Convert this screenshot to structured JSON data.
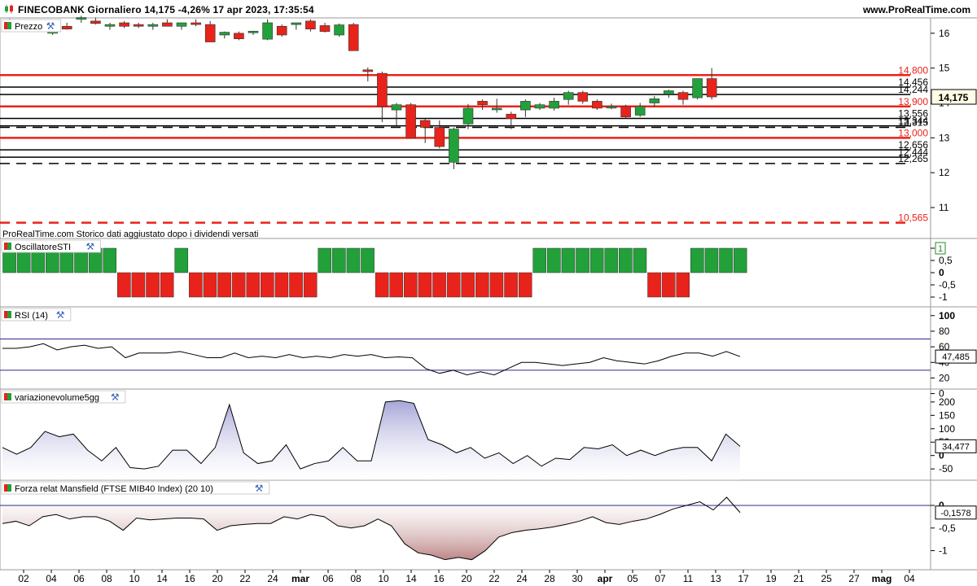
{
  "header": {
    "title": "FINECOBANK Giornaliero 14,175 -4,26% 17 apr 2023, 17:35:54",
    "brand": "www.ProRealTime.com"
  },
  "colors": {
    "bull": "#22a03a",
    "bear": "#e8231b",
    "level_red": "#e8231b",
    "level_black": "#000000",
    "rsi_band": "#2b2b8a",
    "volume_fill": "#b8b8dc",
    "mansfield_fill_neg": "#cfa0a0",
    "mansfield_fill_pos": "#c0dcc0"
  },
  "xaxis": {
    "labels": [
      "02",
      "04",
      "06",
      "08",
      "10",
      "14",
      "16",
      "20",
      "22",
      "24",
      "mar",
      "06",
      "08",
      "10",
      "14",
      "16",
      "20",
      "22",
      "24",
      "28",
      "30",
      "apr",
      "05",
      "07",
      "11",
      "13",
      "17",
      "19",
      "21",
      "25",
      "27",
      "mag",
      "04"
    ],
    "bold": [
      "mar",
      "apr",
      "mag"
    ]
  },
  "chart_data": [
    {
      "type": "candlestick",
      "panel_label": "Prezzo",
      "price_axis": {
        "range": [
          10.3,
          16.3
        ],
        "ticks": [
          "16",
          "15",
          "14",
          "13",
          "12",
          "11"
        ]
      },
      "candles": [
        {
          "i": 0,
          "o": 16.3,
          "h": 16.42,
          "l": 16.22,
          "c": 16.38
        },
        {
          "i": 1,
          "o": 16.25,
          "h": 16.3,
          "l": 16.15,
          "c": 16.17
        },
        {
          "i": 2,
          "o": 16.28,
          "h": 16.35,
          "l": 16.2,
          "c": 16.32
        },
        {
          "i": 3,
          "o": 16.0,
          "h": 16.1,
          "l": 15.95,
          "c": 16.05
        },
        {
          "i": 4,
          "o": 16.2,
          "h": 16.3,
          "l": 16.1,
          "c": 16.12
        },
        {
          "i": 5,
          "o": 16.4,
          "h": 16.5,
          "l": 16.3,
          "c": 16.45
        },
        {
          "i": 6,
          "o": 16.35,
          "h": 16.45,
          "l": 16.25,
          "c": 16.28
        },
        {
          "i": 7,
          "o": 16.2,
          "h": 16.3,
          "l": 16.1,
          "c": 16.25
        },
        {
          "i": 8,
          "o": 16.3,
          "h": 16.35,
          "l": 16.15,
          "c": 16.2
        },
        {
          "i": 9,
          "o": 16.25,
          "h": 16.3,
          "l": 16.15,
          "c": 16.2
        },
        {
          "i": 10,
          "o": 16.2,
          "h": 16.3,
          "l": 16.1,
          "c": 16.25
        },
        {
          "i": 11,
          "o": 16.3,
          "h": 16.4,
          "l": 16.2,
          "c": 16.2
        },
        {
          "i": 12,
          "o": 16.2,
          "h": 16.3,
          "l": 16.1,
          "c": 16.3
        },
        {
          "i": 13,
          "o": 16.3,
          "h": 16.4,
          "l": 16.2,
          "c": 16.25
        },
        {
          "i": 14,
          "o": 16.25,
          "h": 16.35,
          "l": 15.8,
          "c": 15.75
        },
        {
          "i": 15,
          "o": 15.95,
          "h": 16.05,
          "l": 15.85,
          "c": 16.03
        },
        {
          "i": 16,
          "o": 16.0,
          "h": 16.05,
          "l": 15.8,
          "c": 15.84
        },
        {
          "i": 17,
          "o": 16.02,
          "h": 16.07,
          "l": 15.95,
          "c": 16.06
        },
        {
          "i": 18,
          "o": 15.83,
          "h": 16.4,
          "l": 15.8,
          "c": 16.3
        },
        {
          "i": 19,
          "o": 16.2,
          "h": 16.25,
          "l": 15.9,
          "c": 15.95
        },
        {
          "i": 20,
          "o": 16.25,
          "h": 16.3,
          "l": 16.1,
          "c": 16.3
        },
        {
          "i": 21,
          "o": 16.35,
          "h": 16.4,
          "l": 16.05,
          "c": 16.12
        },
        {
          "i": 22,
          "o": 16.22,
          "h": 16.3,
          "l": 16.02,
          "c": 16.05
        },
        {
          "i": 23,
          "o": 15.95,
          "h": 16.28,
          "l": 15.9,
          "c": 16.24
        },
        {
          "i": 24,
          "o": 16.25,
          "h": 16.3,
          "l": 15.5,
          "c": 15.5
        },
        {
          "i": 25,
          "o": 14.95,
          "h": 15.02,
          "l": 14.62,
          "c": 14.9
        },
        {
          "i": 26,
          "o": 14.85,
          "h": 14.9,
          "l": 13.45,
          "c": 13.9
        },
        {
          "i": 27,
          "o": 13.8,
          "h": 14.0,
          "l": 13.35,
          "c": 13.95
        },
        {
          "i": 28,
          "o": 13.95,
          "h": 14.0,
          "l": 13.0,
          "c": 13.0
        },
        {
          "i": 29,
          "o": 13.5,
          "h": 13.55,
          "l": 12.85,
          "c": 13.3
        },
        {
          "i": 30,
          "o": 13.3,
          "h": 13.5,
          "l": 12.7,
          "c": 12.75
        },
        {
          "i": 31,
          "o": 12.3,
          "h": 13.3,
          "l": 12.1,
          "c": 13.25
        },
        {
          "i": 32,
          "o": 13.4,
          "h": 13.97,
          "l": 13.25,
          "c": 13.85
        },
        {
          "i": 33,
          "o": 14.05,
          "h": 14.1,
          "l": 13.8,
          "c": 13.95
        },
        {
          "i": 34,
          "o": 13.85,
          "h": 14.12,
          "l": 13.72,
          "c": 13.85
        },
        {
          "i": 35,
          "o": 13.68,
          "h": 13.75,
          "l": 13.25,
          "c": 13.55
        },
        {
          "i": 36,
          "o": 13.8,
          "h": 14.1,
          "l": 13.6,
          "c": 14.05
        },
        {
          "i": 37,
          "o": 13.85,
          "h": 14.0,
          "l": 13.8,
          "c": 13.95
        },
        {
          "i": 38,
          "o": 13.85,
          "h": 14.15,
          "l": 13.78,
          "c": 14.05
        },
        {
          "i": 39,
          "o": 14.1,
          "h": 14.35,
          "l": 13.95,
          "c": 14.3
        },
        {
          "i": 40,
          "o": 14.3,
          "h": 14.35,
          "l": 13.98,
          "c": 14.05
        },
        {
          "i": 41,
          "o": 14.05,
          "h": 14.1,
          "l": 13.8,
          "c": 13.85
        },
        {
          "i": 42,
          "o": 13.9,
          "h": 13.98,
          "l": 13.82,
          "c": 13.9
        },
        {
          "i": 43,
          "o": 13.9,
          "h": 13.95,
          "l": 13.55,
          "c": 13.6
        },
        {
          "i": 44,
          "o": 13.65,
          "h": 14.0,
          "l": 13.6,
          "c": 13.9
        },
        {
          "i": 45,
          "o": 14.0,
          "h": 14.2,
          "l": 13.88,
          "c": 14.12
        },
        {
          "i": 46,
          "o": 14.25,
          "h": 14.38,
          "l": 14.15,
          "c": 14.35
        },
        {
          "i": 47,
          "o": 14.3,
          "h": 14.35,
          "l": 13.95,
          "c": 14.1
        },
        {
          "i": 48,
          "o": 14.15,
          "h": 14.7,
          "l": 14.1,
          "c": 14.7
        },
        {
          "i": 49,
          "o": 14.7,
          "h": 15.0,
          "l": 14.1,
          "c": 14.175
        }
      ],
      "levels": [
        {
          "value": 14.8,
          "label": "14,800",
          "color": "#e8231b",
          "style": "solid",
          "width": 2.5
        },
        {
          "value": 14.456,
          "label": "14,456",
          "color": "#000000",
          "style": "solid",
          "width": 1.5
        },
        {
          "value": 14.244,
          "label": "14,244",
          "color": "#000000",
          "style": "solid",
          "width": 1.5
        },
        {
          "value": 13.9,
          "label": "13,900",
          "color": "#e8231b",
          "style": "solid",
          "width": 2.5
        },
        {
          "value": 13.556,
          "label": "13,556",
          "color": "#000000",
          "style": "solid",
          "width": 1.5
        },
        {
          "value": 13.344,
          "label": "13,344",
          "color": "#000000",
          "style": "solid",
          "width": 1.5
        },
        {
          "value": 13.3,
          "label": "13,315",
          "color": "#000000",
          "style": "dashed",
          "width": 1.5
        },
        {
          "value": 13.0,
          "label": "13,000",
          "color": "#e8231b",
          "style": "solid",
          "width": 2.5
        },
        {
          "value": 12.656,
          "label": "12,656",
          "color": "#000000",
          "style": "solid",
          "width": 1.5
        },
        {
          "value": 12.444,
          "label": "12,444",
          "color": "#000000",
          "style": "solid",
          "width": 1.5
        },
        {
          "value": 12.265,
          "label": "12,265",
          "color": "#000000",
          "style": "dashed",
          "width": 1.5
        },
        {
          "value": 10.565,
          "label": "10,565",
          "color": "#e8231b",
          "style": "dashed",
          "width": 2.5
        }
      ],
      "last_price": {
        "value": 14.175,
        "label": "14,175"
      },
      "footnote": "ProRealTime.com Storico dati aggiustato dopo i dividendi versati"
    },
    {
      "type": "bar",
      "panel_label": "OscillatoreSTI",
      "axis": {
        "range": [
          -1.2,
          1.2
        ],
        "ticks": [
          "1",
          "0,5",
          "0",
          "-0,5",
          "-1"
        ]
      },
      "current_label": "1",
      "values": [
        1,
        1,
        1,
        1,
        1,
        1,
        1,
        1,
        -1,
        -1,
        -1,
        -1,
        1,
        -1,
        -1,
        -1,
        -1,
        -1,
        -1,
        -1,
        -1,
        -1,
        1,
        1,
        1,
        1,
        -1,
        -1,
        -1,
        -1,
        -1,
        -1,
        -1,
        -1,
        -1,
        -1,
        -1,
        1,
        1,
        1,
        1,
        1,
        1,
        1,
        1,
        -1,
        -1,
        -1,
        1,
        1,
        1,
        1
      ]
    },
    {
      "type": "line",
      "panel_label": "RSI (14)",
      "axis": {
        "range": [
          10,
          105
        ],
        "ticks": [
          "100",
          "80",
          "60",
          "40",
          "20",
          "0"
        ]
      },
      "bands": [
        70,
        30
      ],
      "current_label": "47,485",
      "values": [
        58,
        58,
        60,
        64,
        56,
        60,
        62,
        58,
        60,
        46,
        52,
        52,
        52,
        54,
        50,
        46,
        46,
        52,
        46,
        48,
        46,
        50,
        46,
        48,
        46,
        50,
        48,
        50,
        46,
        47,
        46,
        32,
        26,
        30,
        24,
        28,
        24,
        32,
        40,
        40,
        38,
        36,
        38,
        40,
        46,
        42,
        40,
        38,
        42,
        48,
        52,
        52,
        48,
        54,
        47.485
      ]
    },
    {
      "type": "area",
      "panel_label": "variazionevolume5gg",
      "axis": {
        "range": [
          -80,
          230
        ],
        "ticks": [
          "200",
          "150",
          "100",
          "50",
          "0",
          "-50"
        ]
      },
      "current_label": "34,477",
      "values": [
        30,
        5,
        30,
        90,
        70,
        80,
        20,
        -20,
        30,
        -45,
        -50,
        -40,
        20,
        20,
        -30,
        30,
        190,
        10,
        -30,
        -20,
        40,
        -50,
        -30,
        -20,
        30,
        -20,
        -20,
        200,
        205,
        195,
        60,
        40,
        10,
        30,
        -10,
        10,
        -30,
        0,
        -40,
        -10,
        -15,
        30,
        25,
        40,
        0,
        20,
        0,
        20,
        30,
        30,
        -20,
        80,
        34.477
      ]
    },
    {
      "type": "area",
      "panel_label": "Forza relat Mansfield (FTSE MIB40 Index) (20 10)",
      "axis": {
        "range": [
          -1.35,
          0.45
        ],
        "ticks": [
          "0",
          "-0,5",
          "-1"
        ]
      },
      "current_label": "-0,1578",
      "values": [
        -0.4,
        -0.35,
        -0.45,
        -0.25,
        -0.2,
        -0.3,
        -0.25,
        -0.25,
        -0.35,
        -0.55,
        -0.28,
        -0.32,
        -0.3,
        -0.28,
        -0.28,
        -0.3,
        -0.55,
        -0.45,
        -0.42,
        -0.4,
        -0.4,
        -0.25,
        -0.3,
        -0.2,
        -0.25,
        -0.45,
        -0.5,
        -0.45,
        -0.3,
        -0.45,
        -0.85,
        -1.05,
        -1.1,
        -1.2,
        -1.15,
        -1.2,
        -1.0,
        -0.7,
        -0.6,
        -0.55,
        -0.52,
        -0.48,
        -0.42,
        -0.35,
        -0.25,
        -0.38,
        -0.42,
        -0.35,
        -0.3,
        -0.2,
        -0.08,
        0.0,
        0.08,
        -0.1,
        0.18,
        -0.1578
      ]
    }
  ]
}
